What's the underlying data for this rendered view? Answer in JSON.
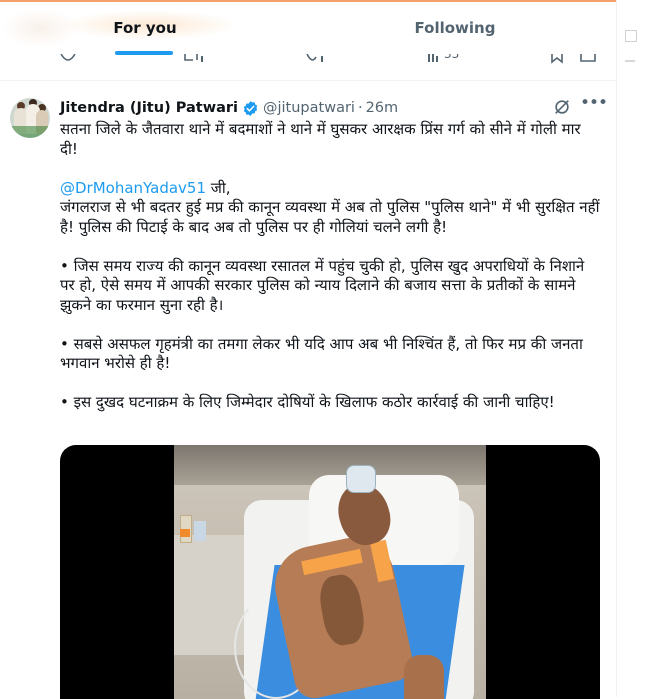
{
  "tabs": {
    "for_you": "For you",
    "following": "Following"
  },
  "prev_actions": {
    "views": "33"
  },
  "tweet": {
    "author_name": "Jitendra (Jitu) Patwari",
    "handle": "@jitupatwari",
    "separator": "·",
    "time": "26m",
    "line1": "सतना जिले के जैतवारा थाने में बदमाशों ने थाने में घुसकर आरक्षक प्रिंस गर्ग को सीने में गोली मार दी!",
    "mention": "@DrMohanYadav51",
    "mention_suffix": " जी,",
    "line2": "जंगलराज से भी बदतर हुई मप्र की कानून व्यवस्था में अब तो पुलिस \"पुलिस थाने\" में भी सुरक्षित नहीं है! पुलिस की पिटाई के बाद अब तो पुलिस पर ही गोलियां चलने लगी है!",
    "bullet1": "• जिस समय राज्य की कानून व्यवस्था रसातल में पहुंच चुकी हो, पुलिस खुद अपराधियों के निशाने पर हो, ऐसे समय में आपकी सरकार पुलिस को न्याय दिलाने की बजाय सत्ता के प्रतीकों के सामने झुकने का फरमान सुना रही है।",
    "bullet2": "• सबसे असफल गृहमंत्री का तमगा लेकर भी यदि आप अब भी निश्चिंत हैं, तो फिर मप्र की जनता भगवान भरोसे ही है!",
    "bullet3": "• इस दुखद घटनाक्रम के लिए जिम्मेदार दोषियों के खिलाफ कठोर कार्रवाई की जानी चाहिए!"
  },
  "icons": {
    "verified": "verified-badge-icon",
    "grok": "grok-icon",
    "more": "more-icon"
  },
  "colors": {
    "accent": "#1d9bf0",
    "text": "#0f1419",
    "muted": "#536471"
  }
}
